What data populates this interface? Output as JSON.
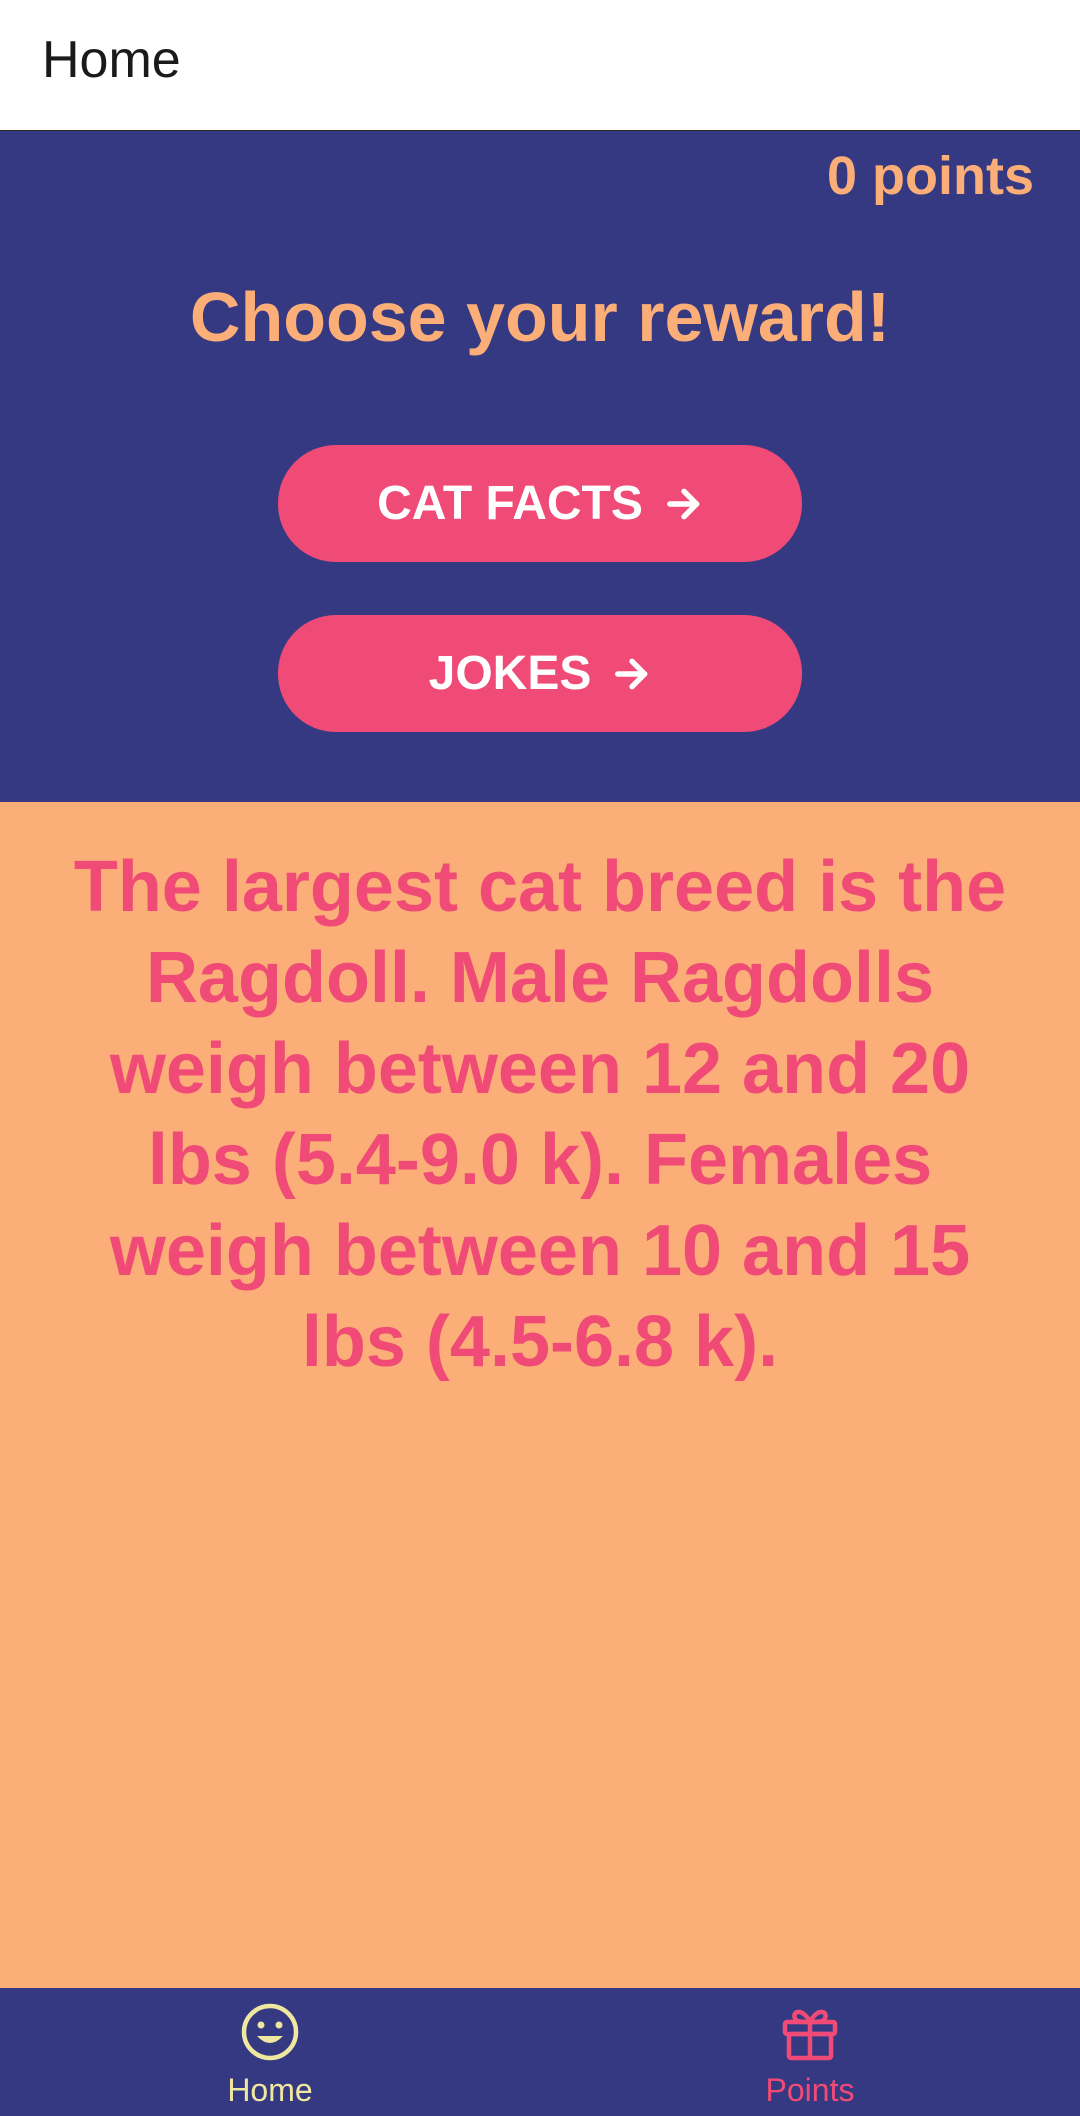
{
  "app_bar": {
    "title": "Home"
  },
  "reward_panel": {
    "points": "0 points",
    "heading": "Choose your reward!",
    "buttons": [
      {
        "label": "CAT FACTS",
        "icon": "arrow-right-icon"
      },
      {
        "label": "JOKES",
        "icon": "arrow-right-icon"
      }
    ]
  },
  "content": {
    "fact": "The largest cat breed is the Ragdoll. Male Ragdolls weigh between 12 and 20 lbs (5.4-9.0 k). Females weigh between 10 and 15 lbs (4.5-6.8 k)."
  },
  "bottom_nav": {
    "items": [
      {
        "label": "Home",
        "icon": "smiley-face-icon",
        "active": true
      },
      {
        "label": "Points",
        "icon": "gift-icon",
        "active": false
      }
    ]
  },
  "colors": {
    "primary_dark": "#343982",
    "accent_pink": "#ef4b76",
    "accent_peach": "#fbae78",
    "active_nav": "#f0e7a0"
  }
}
